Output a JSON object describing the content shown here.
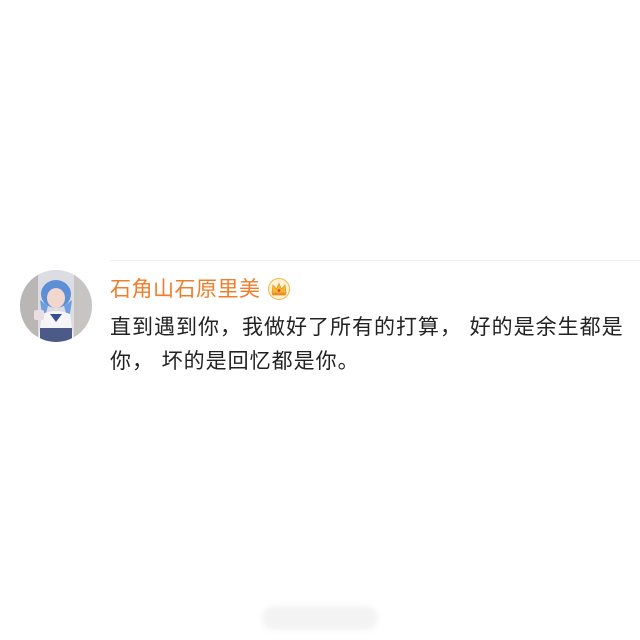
{
  "comment": {
    "username": "石角山石原里美",
    "badge_icon": "crown-icon",
    "text": "直到遇到你，我做好了所有的打算， 好的是余生都是你， 坏的是回忆都是你。"
  },
  "colors": {
    "username": "#f17c2a",
    "text": "#222222",
    "background": "#ffffff"
  }
}
